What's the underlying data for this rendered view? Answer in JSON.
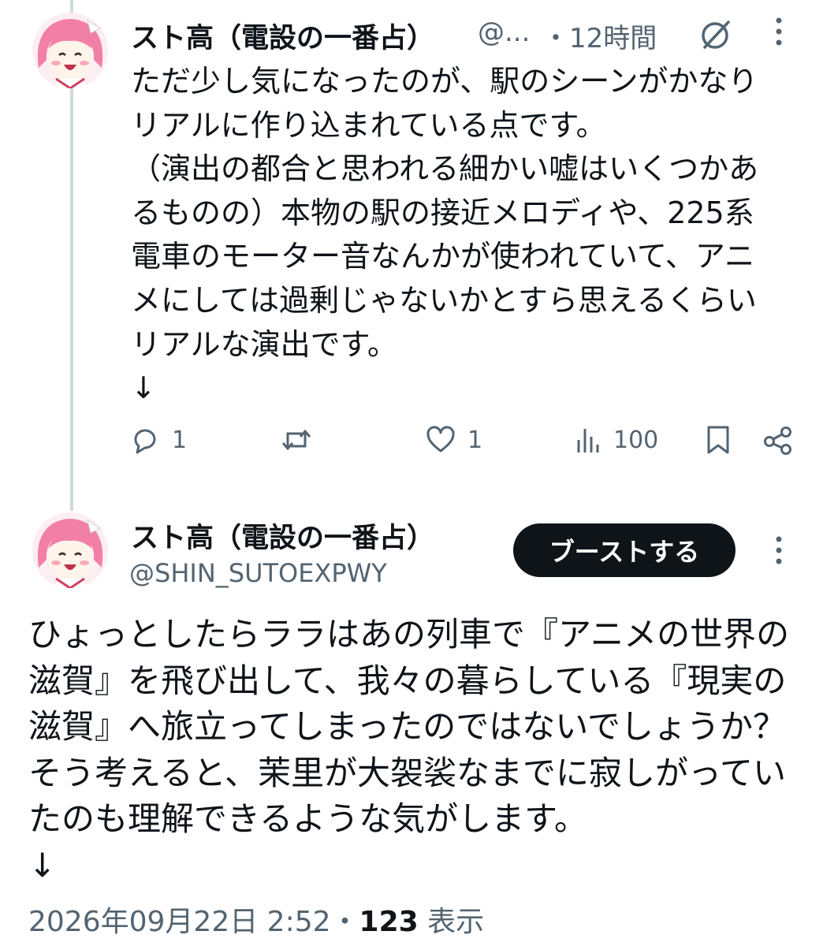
{
  "tweet1": {
    "author_name": "スト高（電設の一番占）",
    "handle": "@...",
    "time": "・12時間",
    "body": "ただ少し気になったのが、駅のシーンがかなり\nリアルに作り込まれている点です。\n（演出の都合と思われる細かい嘘はいくつかあ\nるものの）本物の駅の接近メロディや、225系\n電車のモーター音なんかが使われていて、アニ\nメにしては過剰じゃないかとすら思えるくらい\nリアルな演出です。\n↓",
    "reply_count": "1",
    "like_count": "1",
    "view_count": "100",
    "icons": [
      "grok-icon",
      "more-icon",
      "reply-icon",
      "retweet-icon",
      "like-icon",
      "views-icon",
      "bookmark-icon",
      "share-icon"
    ]
  },
  "tweet2": {
    "author_name": "スト高（電設の一番占）",
    "handle": "@SHIN_SUTOEXPWY",
    "boost_label": "ブーストする",
    "body": "ひょっとしたらララはあの列車で『アニメの世界の\n滋賀』を飛び出して、我々の暮らしている『現実の\n滋賀』へ旅立ってしまったのではないでしょうか？\nそう考えると、茉里が大袈裟なまでに寂しがってい\nたのも理解できるような気がします。\n↓",
    "timestamp": "2026年09月22日 2:52",
    "separator": "・",
    "view_count": "123",
    "view_label": "表示"
  },
  "colors": {
    "text": "#0f1419",
    "secondary": "#536471",
    "thread_line": "#cfd9de",
    "avatar_hair": "#f27fa6"
  }
}
